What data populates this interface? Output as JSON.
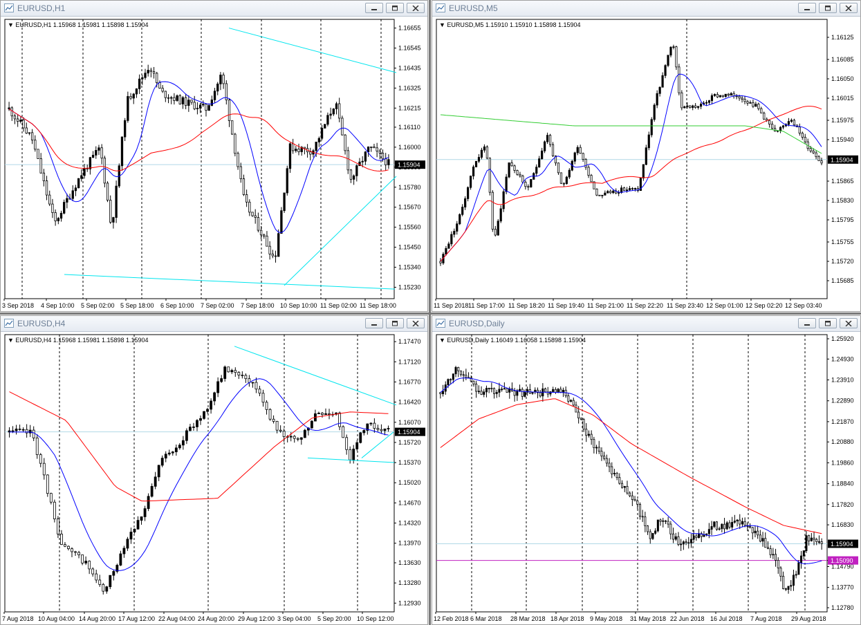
{
  "windows": [
    {
      "id": "h1",
      "title": "EURUSD,H1",
      "info": "▼ EURUSD,H1  1.15968 1.15981 1.15898 1.15904",
      "price_labels": [
        "1.16655",
        "1.16545",
        "1.16435",
        "1.16325",
        "1.16215",
        "1.16110",
        "1.16000",
        "1.15890",
        "1.15780",
        "1.15670",
        "1.15560",
        "1.15450",
        "1.15340",
        "1.15230"
      ],
      "time_labels": [
        "3 Sep 2018",
        "4 Sep 10:00",
        "5 Sep 02:00",
        "5 Sep 18:00",
        "6 Sep 10:00",
        "7 Sep 02:00",
        "7 Sep 18:00",
        "10 Sep 10:00",
        "11 Sep 02:00",
        "11 Sep 18:00"
      ],
      "current_price": "1.15904"
    },
    {
      "id": "m5",
      "title": "EURUSD,M5",
      "info": "▼ EURUSD,M5  1.15910 1.15910 1.15898 1.15904",
      "price_labels": [
        "1.16125",
        "1.16085",
        "1.16050",
        "1.16015",
        "1.15975",
        "1.15940",
        "1.15904",
        "1.15865",
        "1.15830",
        "1.15795",
        "1.15755",
        "1.15720",
        "1.15685"
      ],
      "time_labels": [
        "11 Sep 2018",
        "11 Sep 17:00",
        "11 Sep 18:20",
        "11 Sep 19:40",
        "11 Sep 21:00",
        "11 Sep 22:20",
        "11 Sep 23:40",
        "12 Sep 01:00",
        "12 Sep 02:20",
        "12 Sep 03:40"
      ],
      "current_price": "1.15904"
    },
    {
      "id": "h4",
      "title": "EURUSD,H4",
      "info": "▼ EURUSD,H4  1.15968 1.15981 1.15898 1.15904",
      "price_labels": [
        "1.17470",
        "1.17120",
        "1.16770",
        "1.16420",
        "1.16070",
        "1.15904",
        "1.15720",
        "1.15370",
        "1.15020",
        "1.14670",
        "1.14320",
        "1.13970",
        "1.13630",
        "1.13280",
        "1.12930"
      ],
      "time_labels": [
        "7 Aug 2018",
        "10 Aug 04:00",
        "14 Aug 20:00",
        "17 Aug 12:00",
        "22 Aug 04:00",
        "24 Aug 20:00",
        "29 Aug 12:00",
        "3 Sep 04:00",
        "5 Sep 20:00",
        "10 Sep 12:00"
      ],
      "current_price": "1.15904"
    },
    {
      "id": "d1",
      "title": "EURUSD,Daily",
      "info": "▼ EURUSD,Daily  1.16049 1.16058 1.15898 1.15904",
      "price_labels": [
        "1.25920",
        "1.24930",
        "1.23910",
        "1.22890",
        "1.21870",
        "1.20880",
        "1.19860",
        "1.18840",
        "1.17820",
        "1.16830",
        "1.15904",
        "1.15090",
        "1.14790",
        "1.13770",
        "1.12780"
      ],
      "time_labels": [
        "12 Feb 2018",
        "6 Mar 2018",
        "28 Mar 2018",
        "18 Apr 2018",
        "9 May 2018",
        "31 May 2018",
        "22 Jun 2018",
        "16 Jul 2018",
        "7 Aug 2018",
        "29 Aug 2018"
      ],
      "current_price": "1.15904",
      "level_price": "1.15090"
    }
  ],
  "colors": {
    "candle_bull": "#000000",
    "candle_bear": "#ffffff",
    "ma_fast": "#0000ff",
    "ma_slow": "#ff0000",
    "ma_long": "#32cd32",
    "trendline": "#00e5ee",
    "bid_line": "#b0d8e6",
    "level_line": "#c020c0",
    "grid_separator": "#000000"
  }
}
